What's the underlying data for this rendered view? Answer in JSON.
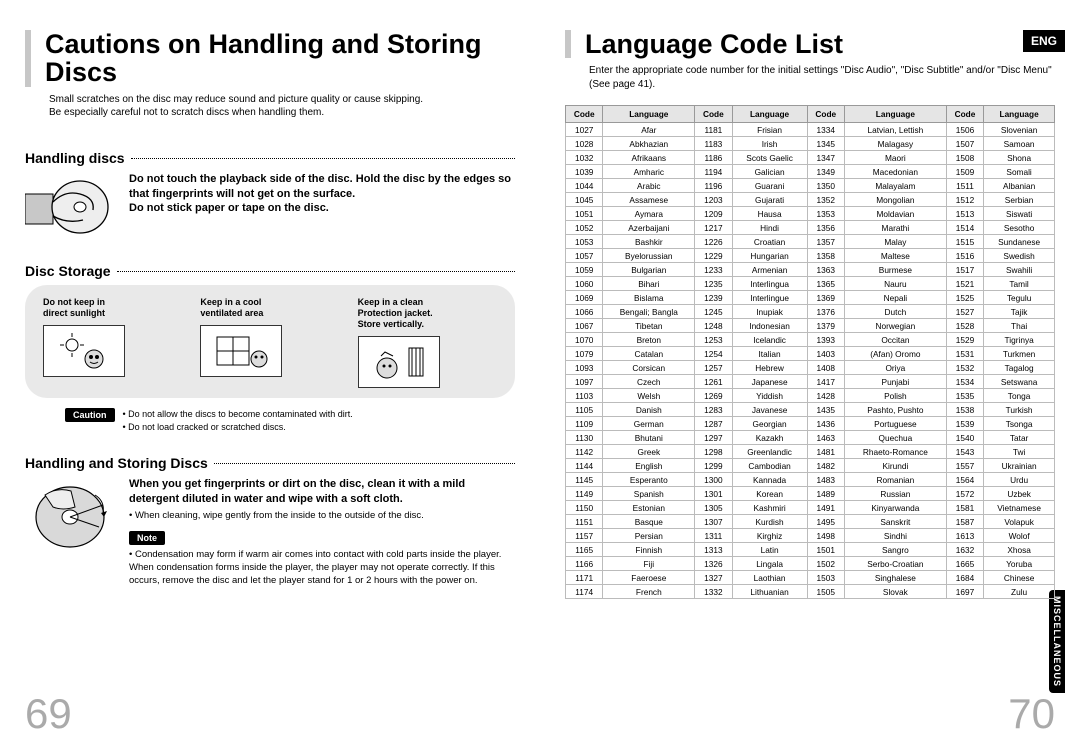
{
  "badges": {
    "eng": "ENG",
    "misc": "MISCELLANEOUS"
  },
  "left": {
    "title": "Cautions on Handling and Storing Discs",
    "intro1": "Small scratches on the disc may reduce sound and picture quality or cause skipping.",
    "intro2": "Be especially careful not to scratch discs when handling them.",
    "sec1": "Handling discs",
    "s1_b1": "Do not touch the playback side of the disc. Hold the disc by the edges so that fingerprints will not get on the surface.",
    "s1_b2": "Do not stick paper or tape on the disc.",
    "sec2": "Disc Storage",
    "storage": [
      {
        "l1": "Do not keep in",
        "l2": "direct sunlight"
      },
      {
        "l1": "Keep in a cool",
        "l2": "ventilated area"
      },
      {
        "l1": "Keep in a clean",
        "l2": "Protection jacket.",
        "l3": "Store vertically."
      }
    ],
    "caution_label": "Caution",
    "caution1": "• Do not allow the discs to become contaminated with dirt.",
    "caution2": "• Do not load cracked or scratched discs.",
    "sec3": "Handling and Storing Discs",
    "s3_b1": "When you get fingerprints or dirt on the disc, clean it with a mild detergent diluted in water and wipe with a soft cloth.",
    "s3_b2": "• When cleaning, wipe gently from the inside to the outside of the disc.",
    "note_label": "Note",
    "note_text": "• Condensation may form if warm air comes into contact with cold parts inside the player. When condensation forms inside the player, the player may not operate correctly. If this occurs, remove the disc and let the player stand for 1 or 2 hours with the power on.",
    "page_num": "69"
  },
  "right": {
    "title": "Language Code List",
    "intro": "Enter the appropriate code number for the initial settings \"Disc Audio\", \"Disc Subtitle\" and/or \"Disc Menu\" (See page 41).",
    "headers": {
      "code": "Code",
      "lang": "Language"
    },
    "rows": [
      [
        "1027",
        "Afar",
        "1181",
        "Frisian",
        "1334",
        "Latvian, Lettish",
        "1506",
        "Slovenian"
      ],
      [
        "1028",
        "Abkhazian",
        "1183",
        "Irish",
        "1345",
        "Malagasy",
        "1507",
        "Samoan"
      ],
      [
        "1032",
        "Afrikaans",
        "1186",
        "Scots Gaelic",
        "1347",
        "Maori",
        "1508",
        "Shona"
      ],
      [
        "1039",
        "Amharic",
        "1194",
        "Galician",
        "1349",
        "Macedonian",
        "1509",
        "Somali"
      ],
      [
        "1044",
        "Arabic",
        "1196",
        "Guarani",
        "1350",
        "Malayalam",
        "1511",
        "Albanian"
      ],
      [
        "1045",
        "Assamese",
        "1203",
        "Gujarati",
        "1352",
        "Mongolian",
        "1512",
        "Serbian"
      ],
      [
        "1051",
        "Aymara",
        "1209",
        "Hausa",
        "1353",
        "Moldavian",
        "1513",
        "Siswati"
      ],
      [
        "1052",
        "Azerbaijani",
        "1217",
        "Hindi",
        "1356",
        "Marathi",
        "1514",
        "Sesotho"
      ],
      [
        "1053",
        "Bashkir",
        "1226",
        "Croatian",
        "1357",
        "Malay",
        "1515",
        "Sundanese"
      ],
      [
        "1057",
        "Byelorussian",
        "1229",
        "Hungarian",
        "1358",
        "Maltese",
        "1516",
        "Swedish"
      ],
      [
        "1059",
        "Bulgarian",
        "1233",
        "Armenian",
        "1363",
        "Burmese",
        "1517",
        "Swahili"
      ],
      [
        "1060",
        "Bihari",
        "1235",
        "Interlingua",
        "1365",
        "Nauru",
        "1521",
        "Tamil"
      ],
      [
        "1069",
        "Bislama",
        "1239",
        "Interlingue",
        "1369",
        "Nepali",
        "1525",
        "Tegulu"
      ],
      [
        "1066",
        "Bengali; Bangla",
        "1245",
        "Inupiak",
        "1376",
        "Dutch",
        "1527",
        "Tajik"
      ],
      [
        "1067",
        "Tibetan",
        "1248",
        "Indonesian",
        "1379",
        "Norwegian",
        "1528",
        "Thai"
      ],
      [
        "1070",
        "Breton",
        "1253",
        "Icelandic",
        "1393",
        "Occitan",
        "1529",
        "Tigrinya"
      ],
      [
        "1079",
        "Catalan",
        "1254",
        "Italian",
        "1403",
        "(Afan) Oromo",
        "1531",
        "Turkmen"
      ],
      [
        "1093",
        "Corsican",
        "1257",
        "Hebrew",
        "1408",
        "Oriya",
        "1532",
        "Tagalog"
      ],
      [
        "1097",
        "Czech",
        "1261",
        "Japanese",
        "1417",
        "Punjabi",
        "1534",
        "Setswana"
      ],
      [
        "1103",
        "Welsh",
        "1269",
        "Yiddish",
        "1428",
        "Polish",
        "1535",
        "Tonga"
      ],
      [
        "1105",
        "Danish",
        "1283",
        "Javanese",
        "1435",
        "Pashto, Pushto",
        "1538",
        "Turkish"
      ],
      [
        "1109",
        "German",
        "1287",
        "Georgian",
        "1436",
        "Portuguese",
        "1539",
        "Tsonga"
      ],
      [
        "1130",
        "Bhutani",
        "1297",
        "Kazakh",
        "1463",
        "Quechua",
        "1540",
        "Tatar"
      ],
      [
        "1142",
        "Greek",
        "1298",
        "Greenlandic",
        "1481",
        "Rhaeto-Romance",
        "1543",
        "Twi"
      ],
      [
        "1144",
        "English",
        "1299",
        "Cambodian",
        "1482",
        "Kirundi",
        "1557",
        "Ukrainian"
      ],
      [
        "1145",
        "Esperanto",
        "1300",
        "Kannada",
        "1483",
        "Romanian",
        "1564",
        "Urdu"
      ],
      [
        "1149",
        "Spanish",
        "1301",
        "Korean",
        "1489",
        "Russian",
        "1572",
        "Uzbek"
      ],
      [
        "1150",
        "Estonian",
        "1305",
        "Kashmiri",
        "1491",
        "Kinyarwanda",
        "1581",
        "Vietnamese"
      ],
      [
        "1151",
        "Basque",
        "1307",
        "Kurdish",
        "1495",
        "Sanskrit",
        "1587",
        "Volapuk"
      ],
      [
        "1157",
        "Persian",
        "1311",
        "Kirghiz",
        "1498",
        "Sindhi",
        "1613",
        "Wolof"
      ],
      [
        "1165",
        "Finnish",
        "1313",
        "Latin",
        "1501",
        "Sangro",
        "1632",
        "Xhosa"
      ],
      [
        "1166",
        "Fiji",
        "1326",
        "Lingala",
        "1502",
        "Serbo-Croatian",
        "1665",
        "Yoruba"
      ],
      [
        "1171",
        "Faeroese",
        "1327",
        "Laothian",
        "1503",
        "Singhalese",
        "1684",
        "Chinese"
      ],
      [
        "1174",
        "French",
        "1332",
        "Lithuanian",
        "1505",
        "Slovak",
        "1697",
        "Zulu"
      ]
    ],
    "page_num": "70"
  }
}
